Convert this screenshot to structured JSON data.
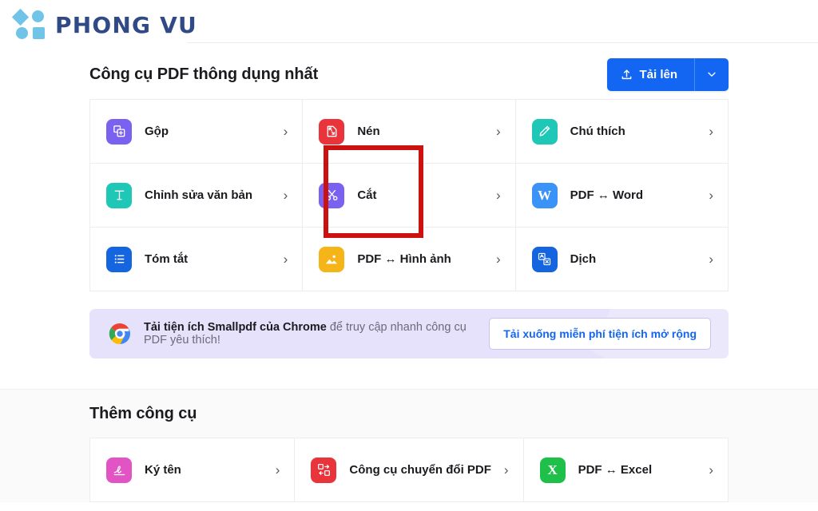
{
  "brand": {
    "name": "PHONG VU",
    "logo_icon": "phongvu-logo-icon"
  },
  "header": {
    "upload_button": "Tải lên",
    "upload_icon": "upload-icon",
    "caret_icon": "chevron-down-icon"
  },
  "sections": [
    {
      "title": "Công cụ PDF thông dụng nhất",
      "tools": [
        {
          "label": "Gộp",
          "icon": "merge-icon",
          "color": "#7b61f0",
          "chevron": "›"
        },
        {
          "label": "Nén",
          "icon": "compress-icon",
          "color": "#e8343a",
          "chevron": "›"
        },
        {
          "label": "Chú thích",
          "icon": "pencil-icon",
          "color": "#1ec7b6",
          "chevron": "›"
        },
        {
          "label": "Chỉnh sửa văn bản",
          "icon": "text-edit-icon",
          "color": "#1ec7b6",
          "chevron": "›"
        },
        {
          "label": "Cắt",
          "icon": "scissors-icon",
          "color": "#7b61f0",
          "chevron": "›"
        },
        {
          "label": "PDF ↔ Word",
          "icon": "word-icon",
          "color": "#3b93f7",
          "chevron": "›"
        },
        {
          "label": "Tóm tắt",
          "icon": "summary-icon",
          "color": "#1565e0",
          "chevron": "›"
        },
        {
          "label": "PDF ↔ Hình ảnh",
          "icon": "image-icon",
          "color": "#f5b418",
          "chevron": "›"
        },
        {
          "label": "Dịch",
          "icon": "translate-icon",
          "color": "#1565e0",
          "chevron": "›"
        }
      ]
    },
    {
      "title": "Thêm công cụ",
      "tools": [
        {
          "label": "Ký tên",
          "icon": "signature-icon",
          "color": "#e254c4",
          "chevron": "›"
        },
        {
          "label": "Công cụ chuyển đổi PDF",
          "icon": "convert-icon",
          "color": "#e8343a",
          "chevron": "›"
        },
        {
          "label": "PDF ↔ Excel",
          "icon": "excel-icon",
          "color": "#1fc04a",
          "chevron": "›"
        }
      ]
    }
  ],
  "banner": {
    "icon": "chrome-icon",
    "text_bold": "Tải tiện ích Smallpdf của Chrome",
    "text_rest": " để truy cập nhanh công cụ PDF yêu thích!",
    "button": "Tải xuống miễn phí tiện ích mở rộng"
  },
  "annotation": {
    "shape": "rectangle",
    "color": "#cc1111",
    "targets": "Nén"
  }
}
